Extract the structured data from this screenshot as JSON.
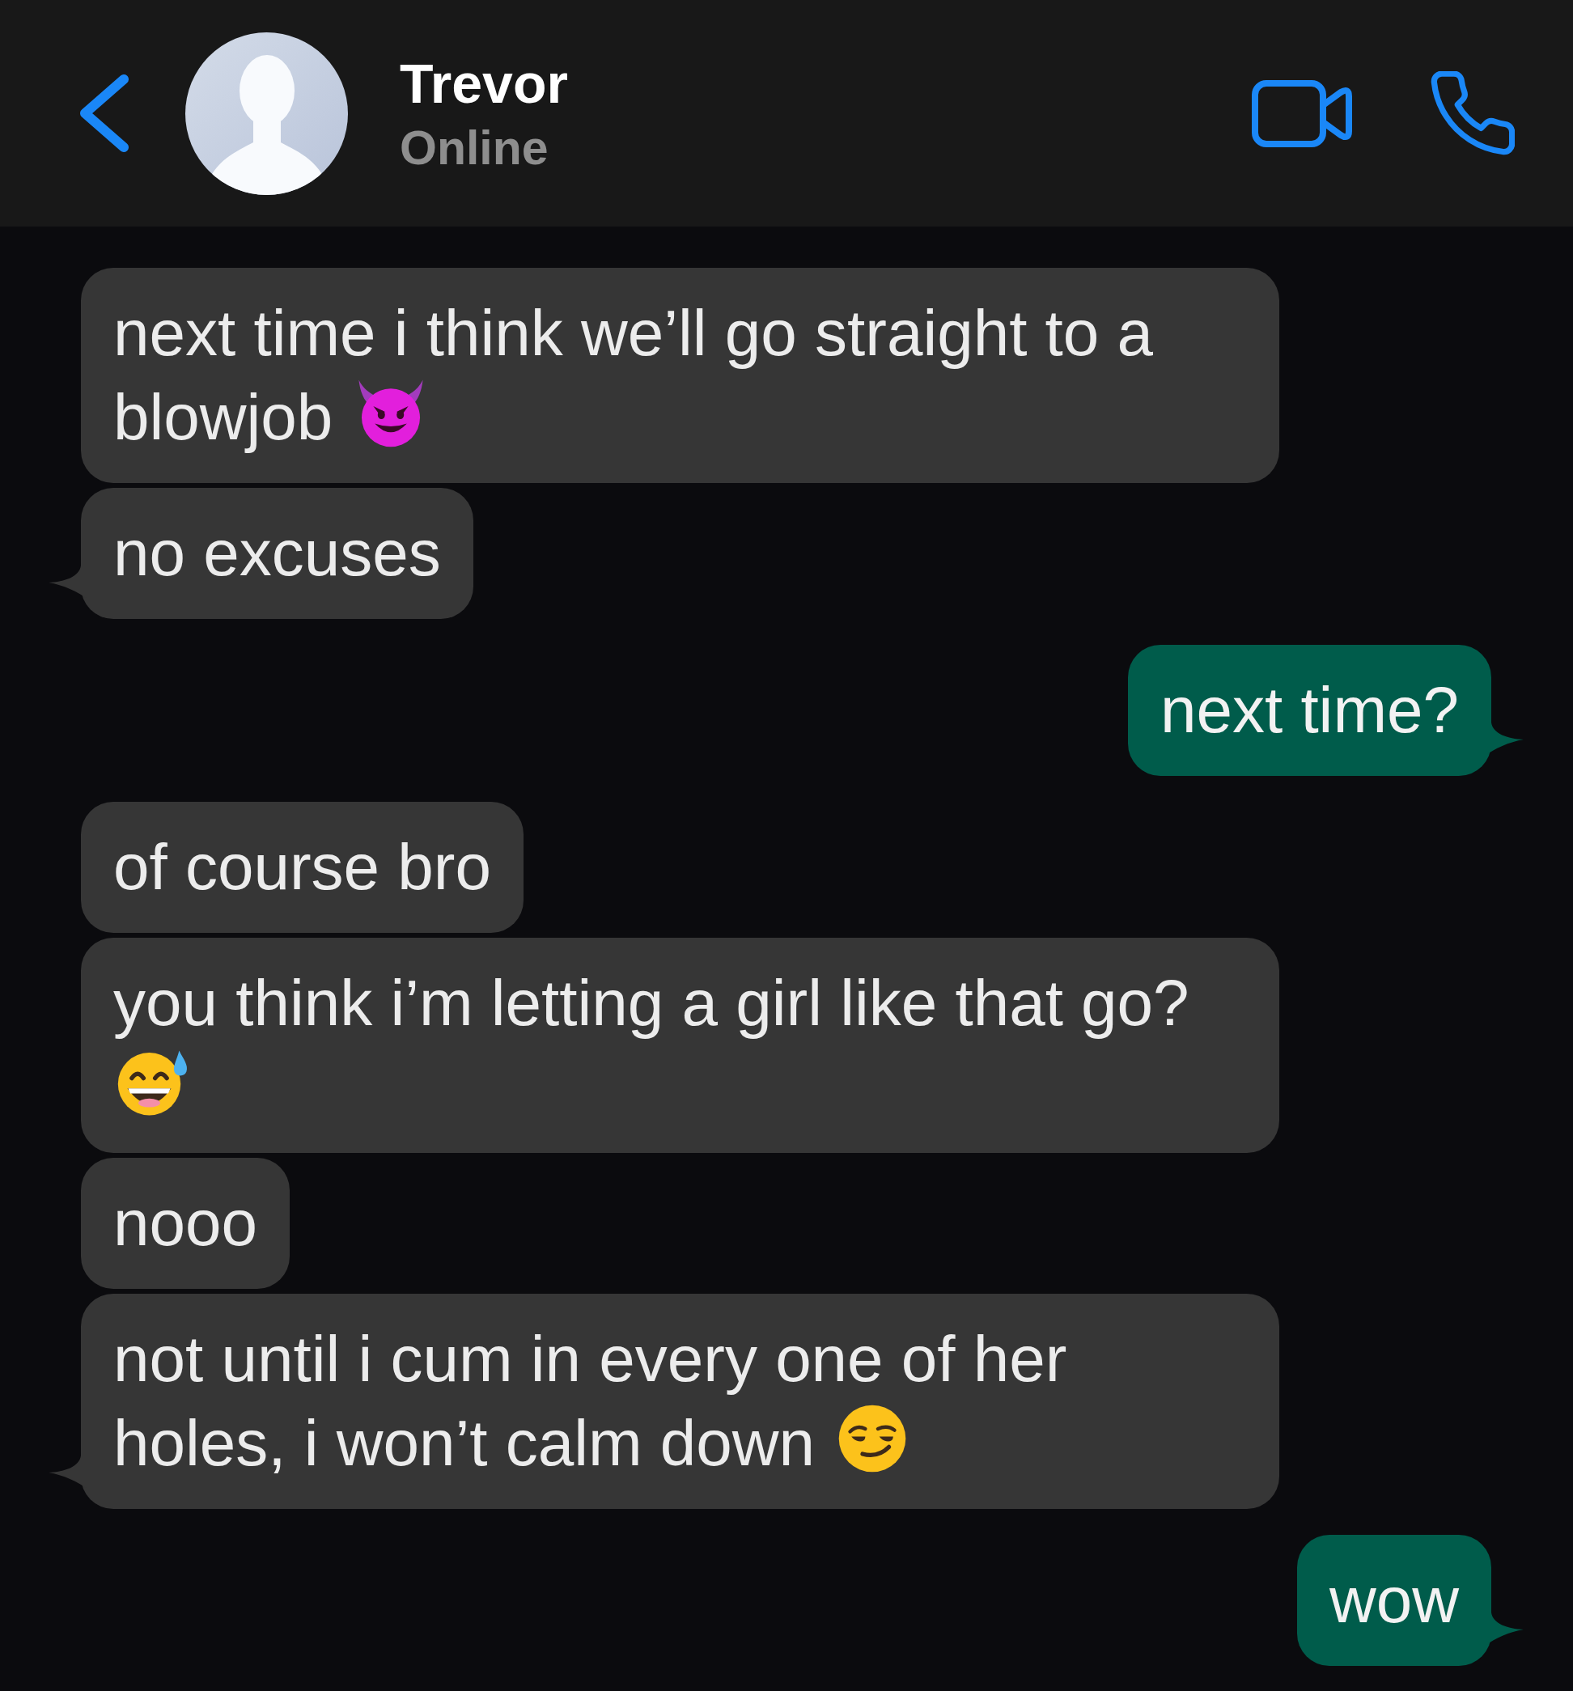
{
  "header": {
    "contact_name": "Trevor",
    "status": "Online"
  },
  "messages": [
    {
      "kind": "incoming",
      "text": "next time i think we’ll go straight to a blowjob",
      "emoji": {
        "kind": "smiling-devil"
      },
      "tail": false
    },
    {
      "kind": "incoming",
      "text": "no excuses",
      "tail": true
    },
    {
      "kind": "outgoing",
      "text": "next time?",
      "tail": true
    },
    {
      "kind": "incoming",
      "text": "of course bro",
      "tail": false
    },
    {
      "kind": "incoming",
      "text": "you think i’m letting a girl like that go?",
      "emoji": {
        "kind": "grinning-sweat"
      },
      "tail": false
    },
    {
      "kind": "incoming",
      "text": "nooo",
      "tail": false
    },
    {
      "kind": "incoming",
      "text": "not until i cum in every one of her holes, i won’t calm down",
      "emoji": {
        "kind": "smirk"
      },
      "tail": true
    },
    {
      "kind": "outgoing",
      "text": "wow",
      "tail": true
    }
  ]
}
